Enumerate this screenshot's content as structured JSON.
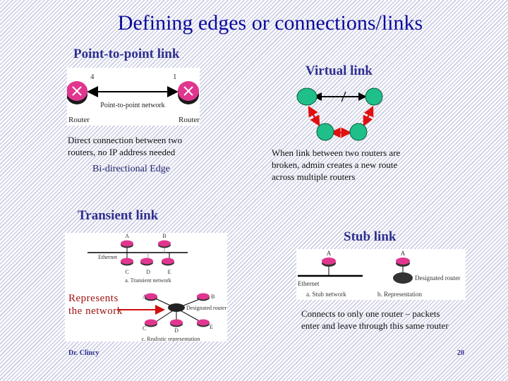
{
  "slide": {
    "title": "Defining edges or connections/links",
    "footer_author": "Dr. Clincy",
    "page_number": "20"
  },
  "point_to_point": {
    "heading": "Point-to-point link",
    "diagram": {
      "left_router_label": "Router",
      "right_router_label": "Router",
      "left_interface": "4",
      "right_interface": "1",
      "network_label": "Point-to-point network"
    },
    "description": "Direct connection between two routers, no IP address needed",
    "edge_caption": "Bi-directional Edge"
  },
  "virtual": {
    "heading": "Virtual link",
    "description": "When link between two routers are broken, admin creates a new route across multiple routers",
    "colors": {
      "node": "#1fbf8a",
      "reroute_arrow": "#e01010",
      "broken_link": "#000000"
    }
  },
  "transient": {
    "heading": "Transient link",
    "diagram": {
      "ethernet_label": "Ethernet",
      "routers_top": [
        "A",
        "B"
      ],
      "routers_bottom": [
        "C",
        "D",
        "E"
      ],
      "caption_a": "a. Transient network",
      "realistic_routers": [
        "A",
        "B",
        "C",
        "D",
        "E"
      ],
      "designated_router_label": "Designated router",
      "caption_c": "c. Realistic representation"
    },
    "annotation": "Represents the network"
  },
  "stub": {
    "heading": "Stub link",
    "diagram": {
      "router_a": "A",
      "router_b": "A",
      "ethernet_label": "Ethernet",
      "designated_router_label": "Designated router",
      "caption_a": "a. Stub network",
      "caption_b": "b. Representation"
    },
    "description": "Connects to only one router – packets enter and leave through this same router"
  },
  "colors": {
    "title": "#0a0a9a",
    "heading": "#2f2f8f",
    "router": "#e0368f",
    "annotation": "#a01010"
  }
}
